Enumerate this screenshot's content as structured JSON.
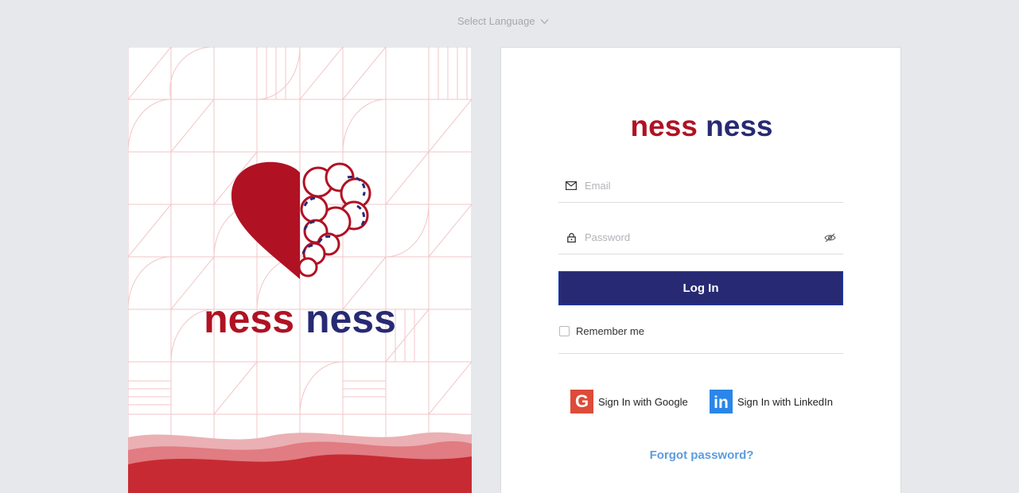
{
  "language_selector": {
    "label": "Select Language"
  },
  "hero": {
    "brand_word_1": "ness",
    "brand_word_2": "ness"
  },
  "card": {
    "logo_word_1": "ness",
    "logo_word_2": "ness",
    "email": {
      "placeholder": "Email",
      "value": ""
    },
    "password": {
      "placeholder": "Password",
      "value": ""
    },
    "login_label": "Log In",
    "remember_label": "Remember me",
    "remember_checked": false,
    "google_label": "Sign In with Google",
    "linkedin_label": "Sign In with LinkedIn",
    "forgot_label": "Forgot password?"
  },
  "colors": {
    "brand_red": "#b01223",
    "brand_navy": "#272a73",
    "link_blue": "#5b9cdf",
    "google_red": "#dd4b39",
    "linkedin_blue": "#2a86e8",
    "page_bg": "#e6e8eb"
  },
  "icons": {
    "language": "chevron-down-icon",
    "email": "envelope-icon",
    "password": "lock-icon",
    "toggle": "eye-off-icon",
    "google": "google-icon",
    "linkedin": "linkedin-icon"
  }
}
